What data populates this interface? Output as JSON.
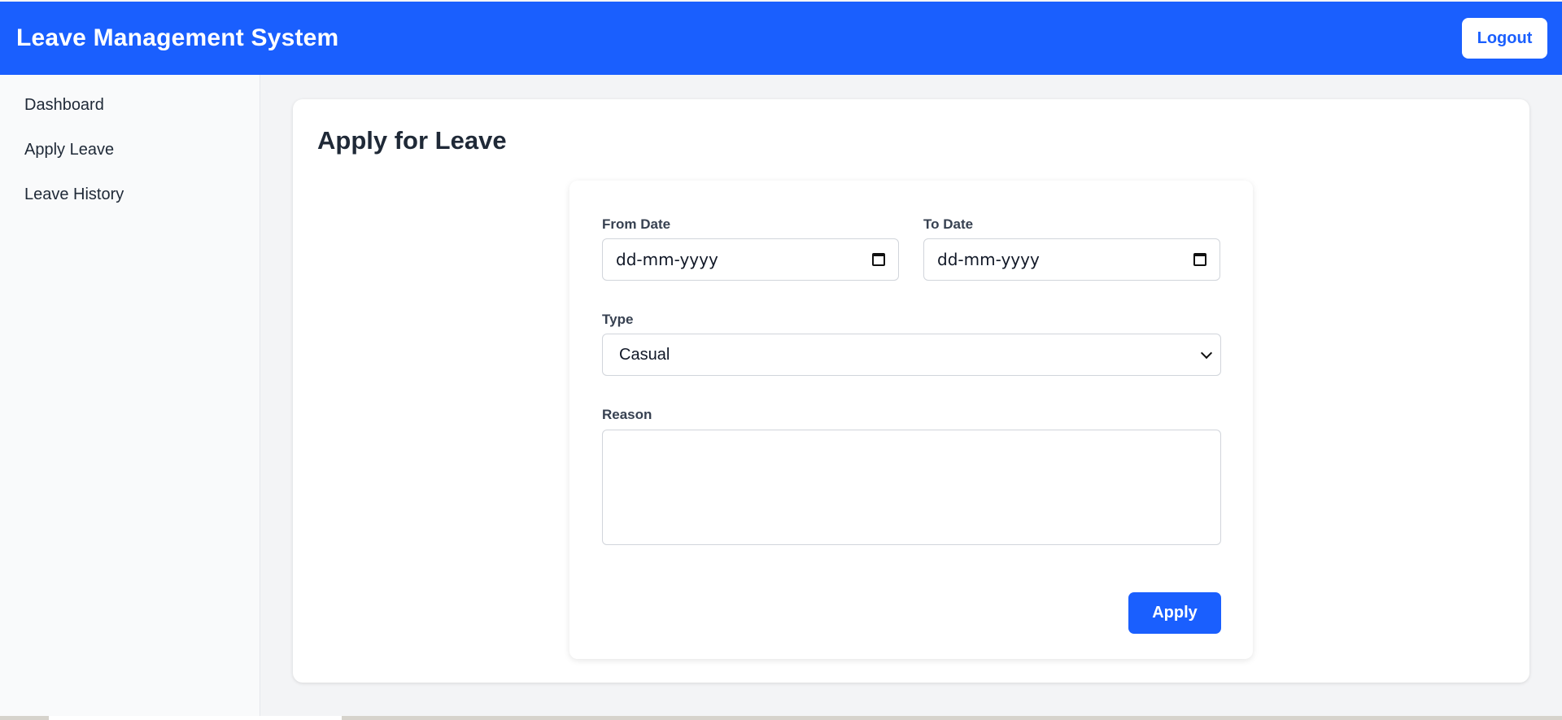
{
  "header": {
    "title": "Leave Management System",
    "logout_label": "Logout",
    "accent_color": "#1a5ffe"
  },
  "sidebar": {
    "items": [
      {
        "label": "Dashboard"
      },
      {
        "label": "Apply Leave"
      },
      {
        "label": "Leave History"
      }
    ]
  },
  "main": {
    "title": "Apply for Leave",
    "form": {
      "from_date": {
        "label": "From Date",
        "placeholder": "dd-mm-yyyy",
        "icon": "calendar-icon"
      },
      "to_date": {
        "label": "To Date",
        "placeholder": "dd-mm-yyyy",
        "icon": "calendar-icon"
      },
      "type": {
        "label": "Type",
        "selected": "Casual",
        "icon": "chevron-down-icon"
      },
      "reason": {
        "label": "Reason",
        "value": ""
      },
      "apply_label": "Apply"
    }
  }
}
